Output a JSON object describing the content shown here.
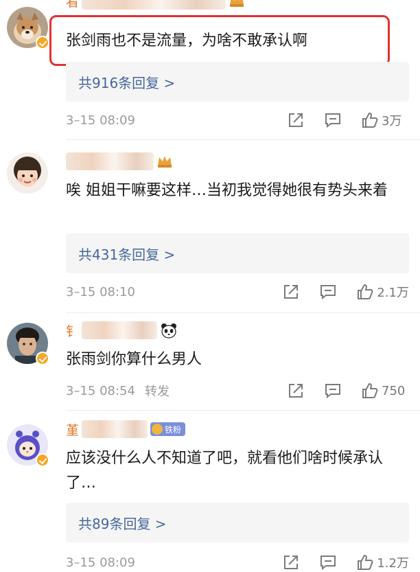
{
  "comments": [
    {
      "username": "看",
      "text": "张剑雨也不是流量，为啥不敢承认啊",
      "replies": "共916条回复 >",
      "date": "3–15 08:09",
      "forward": "",
      "likes": "3万"
    },
    {
      "username": "",
      "text": "唉 姐姐干嘛要这样…当初我觉得她很有势头来着",
      "replies": "共431条回复 >",
      "date": "3–15 08:10",
      "forward": "",
      "likes": "2.1万"
    },
    {
      "username": "钅",
      "text": "张雨剑你算什么男人",
      "replies": "",
      "date": "3–15 08:54",
      "forward": "转发",
      "likes": "750"
    },
    {
      "username": "堇",
      "badge": "铁粉",
      "text": "应该没什么人不知道了吧，就看他们啥时候承认了…",
      "replies": "共89条回复 >",
      "date": "3–15 08:09",
      "forward": "",
      "likes": "1.2万"
    }
  ],
  "colors": {
    "username": "#e07628",
    "reply_link": "#45679a",
    "highlight": "#e0322e",
    "verified": "#f6a623"
  },
  "icons": [
    "share-icon",
    "comment-icon",
    "like-icon",
    "crown-icon",
    "panda-icon",
    "verified-badge-icon"
  ]
}
